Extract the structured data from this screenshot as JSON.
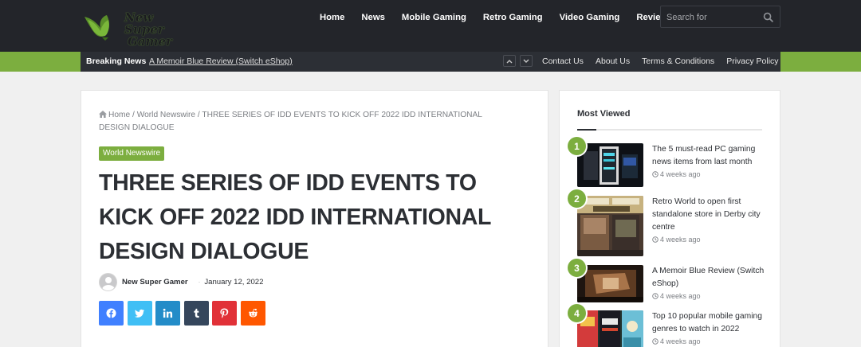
{
  "brand": {
    "logo_line1": "New Super",
    "logo_line2": "Gamer",
    "accent_color": "#7cae3f"
  },
  "nav": {
    "items": [
      "Home",
      "News",
      "Mobile Gaming",
      "Retro Gaming",
      "Video Gaming",
      "Reviews"
    ],
    "search_placeholder": "Search for"
  },
  "subbar": {
    "breaking_label": "Breaking News",
    "breaking_item": "A Memoir Blue Review (Switch eShop)",
    "links": [
      "Contact Us",
      "About Us",
      "Terms & Conditions",
      "Privacy Policy"
    ]
  },
  "article": {
    "breadcrumb": {
      "home": "Home",
      "sep": " / ",
      "category": "World Newswire",
      "current": "THREE SERIES OF IDD EVENTS TO KICK OFF 2022 IDD INTERNATIONAL DESIGN DIALOGUE"
    },
    "category_badge": "World Newswire",
    "title": "THREE SERIES OF IDD EVENTS TO KICK OFF 2022 IDD INTERNATIONAL DESIGN DIALOGUE",
    "author": "New Super Gamer",
    "meta_dot": "·",
    "date": "January 12, 2022",
    "share_buttons": [
      {
        "name": "facebook",
        "color": "#4080ff"
      },
      {
        "name": "twitter",
        "color": "#40bff5"
      },
      {
        "name": "linkedin",
        "color": "#238cc8"
      },
      {
        "name": "tumblr",
        "color": "#35465c"
      },
      {
        "name": "pinterest",
        "color": "#e13138"
      },
      {
        "name": "reddit",
        "color": "#ff5700"
      }
    ]
  },
  "sidebar": {
    "widget_title": "Most Viewed",
    "posts": [
      {
        "num": "1",
        "title": "The 5 must-read PC gaming news items from last month",
        "time": "4 weeks ago"
      },
      {
        "num": "2",
        "title": "Retro World to open first standalone store in Derby city centre",
        "time": "4 weeks ago"
      },
      {
        "num": "3",
        "title": "A Memoir Blue Review (Switch eShop)",
        "time": "4 weeks ago"
      },
      {
        "num": "4",
        "title": "Top 10 popular mobile gaming genres to watch in 2022",
        "time": "4 weeks ago"
      }
    ]
  }
}
